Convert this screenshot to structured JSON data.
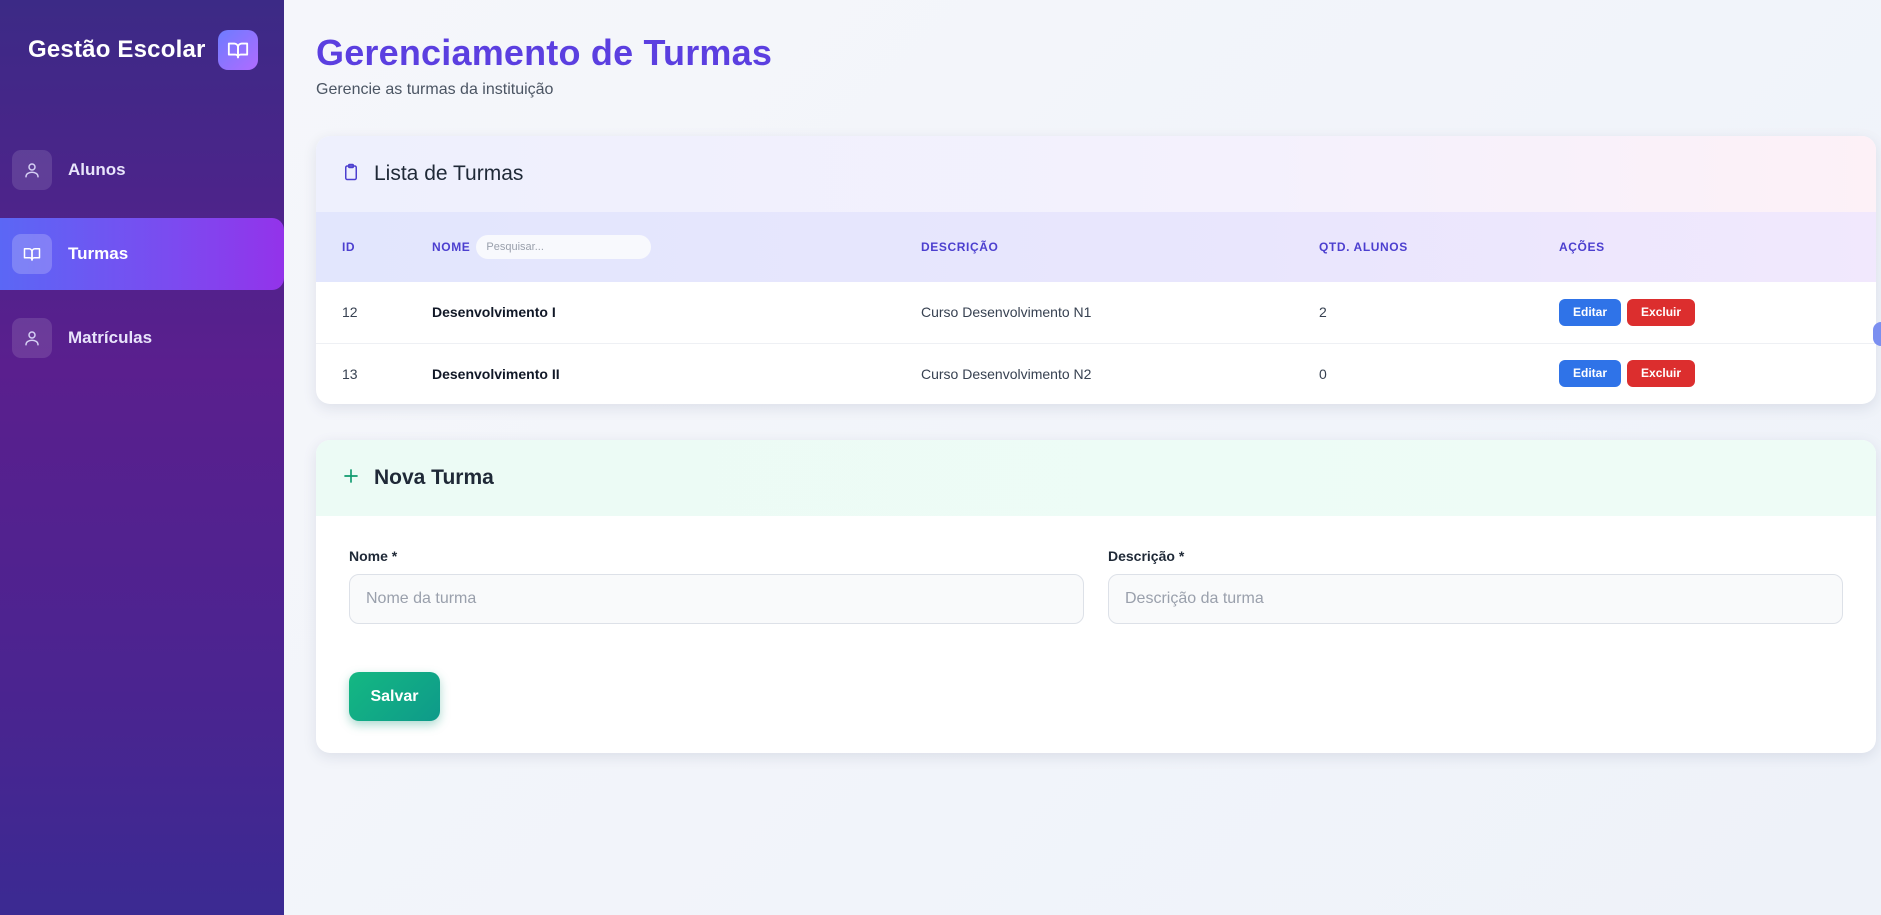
{
  "sidebar": {
    "brand_title": "Gestão Escolar",
    "brand_icon": "open-book-icon",
    "items": [
      {
        "label": "Alunos",
        "icon": "person-icon",
        "active": false
      },
      {
        "label": "Turmas",
        "icon": "open-book-icon",
        "active": true
      },
      {
        "label": "Matrículas",
        "icon": "person-icon",
        "active": false
      }
    ]
  },
  "header": {
    "title": "Gerenciamento de Turmas",
    "subtitle": "Gerencie as turmas da instituição"
  },
  "list_card": {
    "title": "Lista de Turmas",
    "icon": "clipboard-icon",
    "columns": {
      "id": "ID",
      "nome": "NOME",
      "descricao": "DESCRIÇÃO",
      "qtd": "QTD. ALUNOS",
      "acoes": "AÇÕES"
    },
    "search_placeholder": "Pesquisar...",
    "rows": [
      {
        "id": "12",
        "nome": "Desenvolvimento I",
        "descricao": "Curso Desenvolvimento N1",
        "qtd": "2"
      },
      {
        "id": "13",
        "nome": "Desenvolvimento II",
        "descricao": "Curso Desenvolvimento N2",
        "qtd": "0"
      }
    ],
    "edit_label": "Editar",
    "delete_label": "Excluir"
  },
  "form_card": {
    "title": "Nova Turma",
    "icon": "plus-icon",
    "nome_label": "Nome *",
    "nome_placeholder": "Nome da turma",
    "descricao_label": "Descrição *",
    "descricao_placeholder": "Descrição da turma",
    "save_label": "Salvar"
  },
  "colors": {
    "accent": "#5b3fe0",
    "edit": "#2f73e8",
    "delete": "#dc2e2e",
    "save": "#14b882"
  }
}
